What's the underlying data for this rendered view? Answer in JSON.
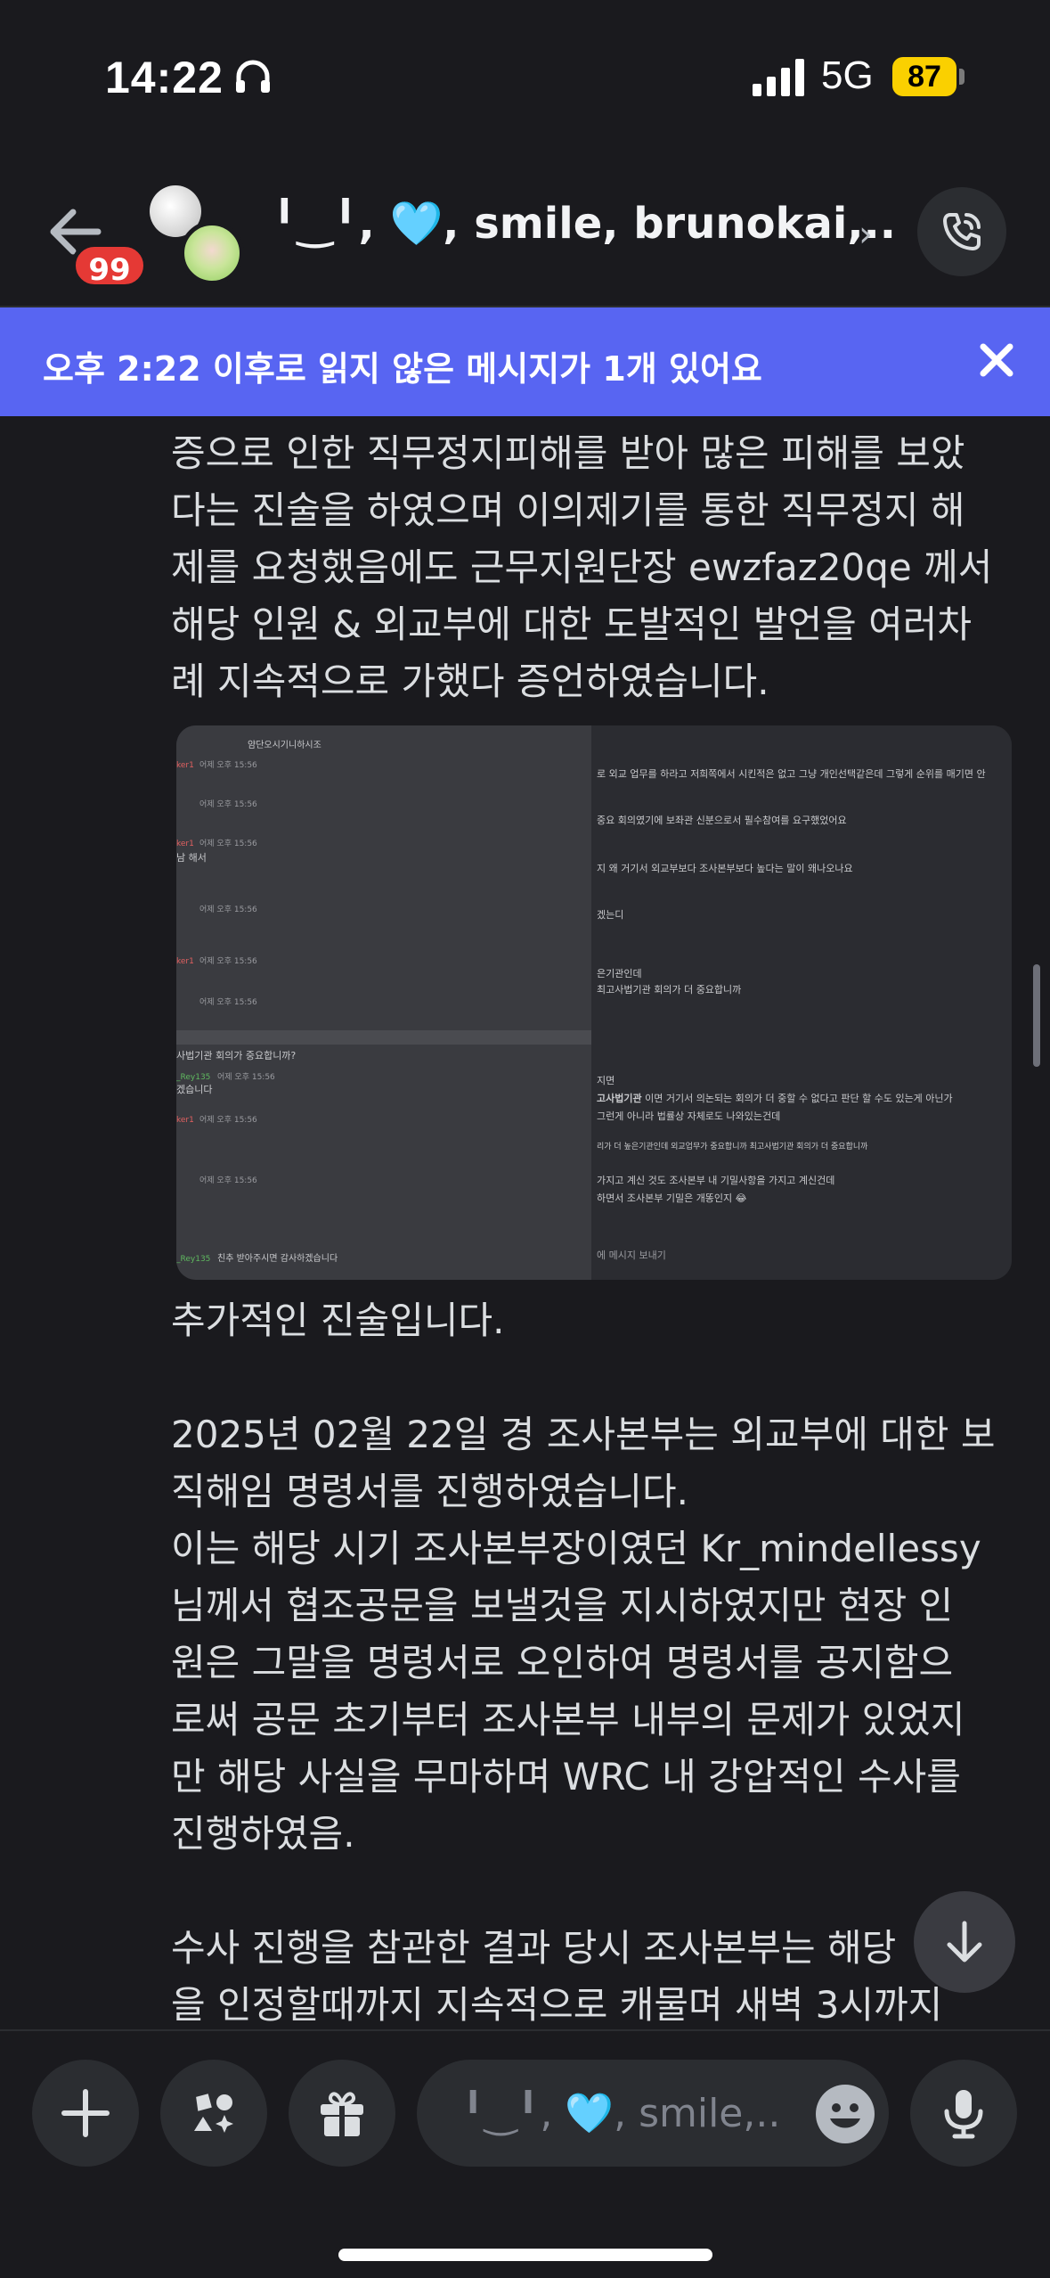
{
  "status_bar": {
    "time": "14:22",
    "network": "5G",
    "battery": "87"
  },
  "header": {
    "badge_count": "99",
    "title": "╹‿╹, 🩵, smile, brunokai,...",
    "chevron": "›"
  },
  "unread_banner": {
    "text": "오후 2:22 이후로 읽지 않은 메시지가 1개 있어요",
    "close": "✕"
  },
  "messages": {
    "block1": [
      "증으로 인한 직무정지피해를 받아 많은 피해를 보았",
      "다는 진술을 하였으며 이의제기를 통한 직무정지 해",
      "제를 요청했음에도 근무지원단장 ewzfaz20qe 께서",
      "해당 인원 & 외교부에 대한 도발적인 발언을 여러차",
      "례 지속적으로 가했다 증언하였습니다."
    ],
    "block2": [
      "추가적인 진술입니다.",
      "",
      "2025년 02월 22일 경 조사본부는 외교부에 대한 보",
      "직해임 명령서를 진행하였습니다.",
      "이는 해당 시기 조사본부장이였던 Kr_mindellessy",
      "님께서 협조공문을 보낼것을 지시하였지만 현장 인",
      "원은 그말을 명령서로 오인하여 명령서를 공지함으",
      "로써 공문 초기부터 조사본부 내부의 문제가 있었지",
      "만 해당 사실을 무마하며 WRC 내 강압적인 수사를",
      "진행하였음.",
      "",
      "수사 진행을 참관한 결과 당시 조사본부는 해당",
      "을 인정할때까지 지속적으로 캐물며 새벽 3시까지"
    ]
  },
  "embedded_screenshot": {
    "left": {
      "header": "얌단오시기니하시조",
      "name_red_1": "ker1",
      "time_1": "어제 오후 15:56",
      "time_2": "어제 오후 15:56",
      "name_red_2": "ker1",
      "time_3": "어제 오후 15:56",
      "line_1": "남 해서",
      "time_4": "어제 오후 15:56",
      "name_red_3": "ker1",
      "time_5": "어제 오후 15:56",
      "time_6": "어제 오후 15:56",
      "line_2": "사법기관 회의가 중요합니까?",
      "name_green_1": "_Rey135",
      "time_7": "어제 오후 15:56",
      "line_3": "겠습니다",
      "name_red_4": "ker1",
      "time_8": "어제 오후 15:56",
      "time_9": "어제 오후 15:56",
      "name_green_2": "_Rey135",
      "footer": "친추 받아주시면 감사하겠습니다"
    },
    "right": {
      "line_1": "로 외교 업무를 하라고 저희쪽에서 시킨적은 없고 그냥 개인선택같은데 그렇게 순위를 매기면 안",
      "line_2": "중요 회의였기에 보좌관 신분으로서 필수참여를 요구했었어요",
      "line_3": "지 왜 거기서 외교부보다 조사본부보다 높다는 말이 왜나오나요",
      "line_4": "겠는디",
      "line_5": "은기관인데",
      "line_6": "최고사법기관 회의가 더 중요합니까",
      "line_7": "지면",
      "line_8_bold": "고사법기관",
      "line_8": " 이면 거기서 의논되는 회의가 더 중할 수 없다고 판단 할 수도 있는게 아닌가",
      "line_9": "그런게 아니라 법률상 자체로도 나와있는건데",
      "line_10": "리가 더 높은기관인데 외교업무가 중요합니까 최고사법기관 회의가 더 중요합니까",
      "line_11": "가지고 계신 것도 조사본부 내 기밀사항을 가지고 계신건데",
      "line_12": "하면서 조사본부 기밀은 개똥인지 😂",
      "input_placeholder": "에 메시지 보내기"
    }
  },
  "input_bar": {
    "placeholder": "╹‿╹, 🩵, smile,..."
  },
  "colors": {
    "background": "#1a1a1e",
    "banner": "#5865f2",
    "badge": "#e53935",
    "battery": "#fad000",
    "button_bg": "#2b2d31"
  },
  "icons": [
    "headphones-icon",
    "signal-icon",
    "back-arrow-icon",
    "phone-call-icon",
    "close-icon",
    "arrow-down-icon",
    "plus-icon",
    "apps-icon",
    "gift-icon",
    "emoji-icon",
    "microphone-icon"
  ]
}
